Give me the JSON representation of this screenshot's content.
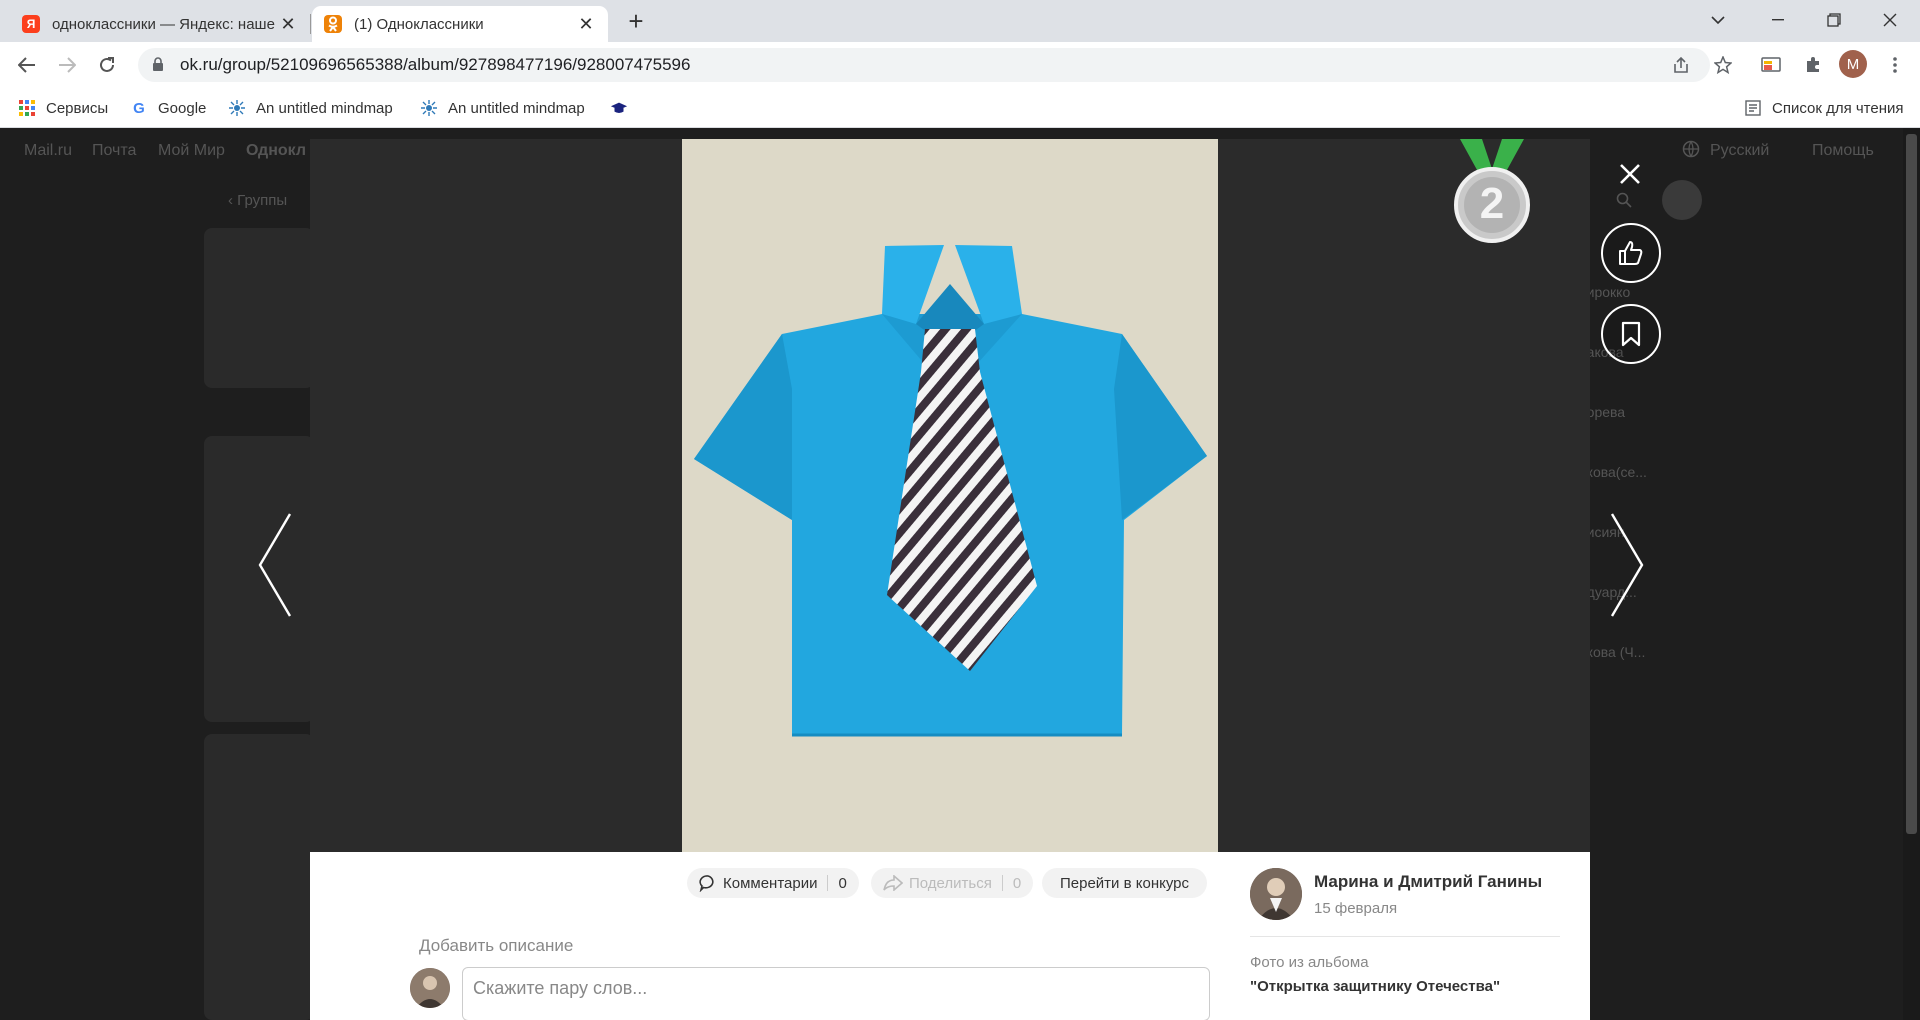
{
  "browser": {
    "tabs": [
      {
        "title": "одноклассники — Яндекс: наше",
        "favicon_letter": "Я",
        "favicon_color": "#fc3f1d"
      },
      {
        "title": "(1) Одноклассники",
        "favicon_letter": "ok",
        "favicon_color": "#ee8208"
      }
    ],
    "url": "ok.ru/group/52109696565388/album/927898477196/928007475596",
    "profile_letter": "M",
    "bookmarks": [
      {
        "label": "Сервисы",
        "icon": "apps-grid-icon"
      },
      {
        "label": "Google",
        "icon": "google-g-icon"
      },
      {
        "label": "An untitled mindmap",
        "icon": "mindmap-icon"
      },
      {
        "label": "An untitled mindmap",
        "icon": "mindmap-icon"
      },
      {
        "label": "",
        "icon": "graduation-cap-icon"
      }
    ],
    "reading_list": "Список для чтения"
  },
  "background_page": {
    "nav": [
      "Mail.ru",
      "Почта",
      "Мой Мир",
      "Однокл"
    ],
    "language": "Русский",
    "help": "Помощь",
    "groups_link": "Группы",
    "member_names": [
      "...ирокко",
      "...акова",
      "...орева",
      "...кова(се...",
      "...исиян",
      "...дуард...",
      "...кова (Ч..."
    ]
  },
  "viewer": {
    "medal_number": "2",
    "comments_label": "Комментарии",
    "comments_count": "0",
    "share_label": "Поделиться",
    "share_count": "0",
    "contest_label": "Перейти в конкурс",
    "add_description": "Добавить описание",
    "comment_placeholder": "Скажите пару слов...",
    "author_name": "Марина и Дмитрий Ганины",
    "author_date": "15 февраля",
    "album_label": "Фото из альбома",
    "album_name": "\"Открытка защитнику Отечества\""
  },
  "colors": {
    "shirt": "#1fa3dc",
    "medal_ribbon": "#3ab14a",
    "medal_silver": "#c9c9c9"
  }
}
